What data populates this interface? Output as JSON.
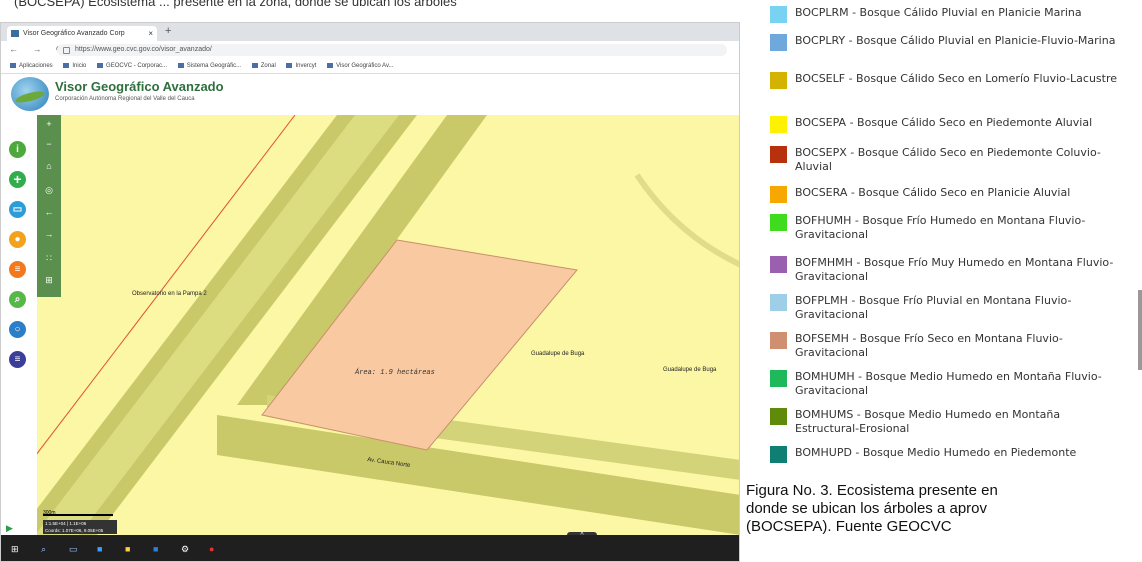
{
  "doc_top_text": "(BOCSEPA) Ecosistema ... presente en la zona, donde se ubican los árboles",
  "browser": {
    "tab_title": "Visor Geográfico Avanzado Corp",
    "tab_close": "×",
    "new_tab": "+",
    "nav": "←  →  ⟳  ⌂",
    "url": "https://www.geo.cvc.gov.co/visor_avanzado/",
    "bookmarks": [
      "Aplicaciones",
      "Inicio",
      "GEOCVC - Corporac...",
      "Sistema Geográfic...",
      "Zonal",
      "Invercyt",
      "Visor Geográfico Av..."
    ]
  },
  "app": {
    "title": "Visor Geográfico Avanzado",
    "subtitle": "Corporación Autónoma Regional del Valle del Cauca"
  },
  "toolbar": {
    "zoom_in": "+",
    "zoom_out": "−",
    "home": "⌂",
    "locate": "◎",
    "back": "←",
    "forward": "→",
    "grid": "∷",
    "layers": "⊞"
  },
  "map": {
    "label_left": "Observatorio en la Pampa 2",
    "label_center": "Guadalupe de Buga",
    "label_right": "Guadalupe de Buga",
    "area_label": "Área: 1.9 hectáreas",
    "road_label": "Av. Cauca Norte",
    "scale_text": "300m",
    "coord_text": "1:1.5E+04 | 1.1E+06",
    "coord_text2": "Coords: 1.07E+06, 9.05E+05"
  },
  "taskbar": {
    "collapse": "^"
  },
  "legend": [
    {
      "text": "BOCPLRM - Bosque Cálido Pluvial en Planicie Marina",
      "color": "#78d3f2"
    },
    {
      "text": "BOCPLRY - Bosque Cálido Pluvial en Planicie-Fluvio-Marina",
      "color": "#6fa8dc"
    },
    {
      "text": "BOCSELF - Bosque Cálido Seco en Lomerío Fluvio-Lacustre",
      "color": "#d4b300"
    },
    {
      "text": "BOCSEPA - Bosque Cálido Seco en Piedemonte Aluvial",
      "color": "#fff200"
    },
    {
      "text": "BOCSEPX - Bosque Cálido Seco en Piedemonte Coluvio-Aluvial",
      "color": "#b8310d"
    },
    {
      "text": "BOCSERA - Bosque Cálido Seco en Planicie Aluvial",
      "color": "#f6a800"
    },
    {
      "text": "BOFHUMH - Bosque Frío Humedo en Montana Fluvio-Gravitacional",
      "color": "#3fdb1f"
    },
    {
      "text": "BOFMHMH - Bosque Frío Muy Humedo en Montana Fluvio-Gravitacional",
      "color": "#9b5fb0"
    },
    {
      "text": "BOFPLMH - Bosque Frío Pluvial en Montana Fluvio-Gravitacional",
      "color": "#9fcfe8"
    },
    {
      "text": "BOFSEMH - Bosque Frío Seco en Montana Fluvio-Gravitacional",
      "color": "#cf8f70"
    },
    {
      "text": "BOMHUMH - Bosque Medio Humedo en Montaña Fluvio-Gravitacional",
      "color": "#1fb85a"
    },
    {
      "text": "BOMHUMS - Bosque Medio Humedo en Montaña Estructural-Erosional",
      "color": "#5f8a0a"
    },
    {
      "text": "BOMHUPD - Bosque Medio Humedo en Piedemonte",
      "color": "#0f7f73"
    }
  ],
  "caption": {
    "line1": "Figura No. 3. Ecosistema presente en",
    "line2": "donde se ubican los árboles a aprov",
    "line3": "(BOCSEPA). Fuente GEOCVC"
  }
}
